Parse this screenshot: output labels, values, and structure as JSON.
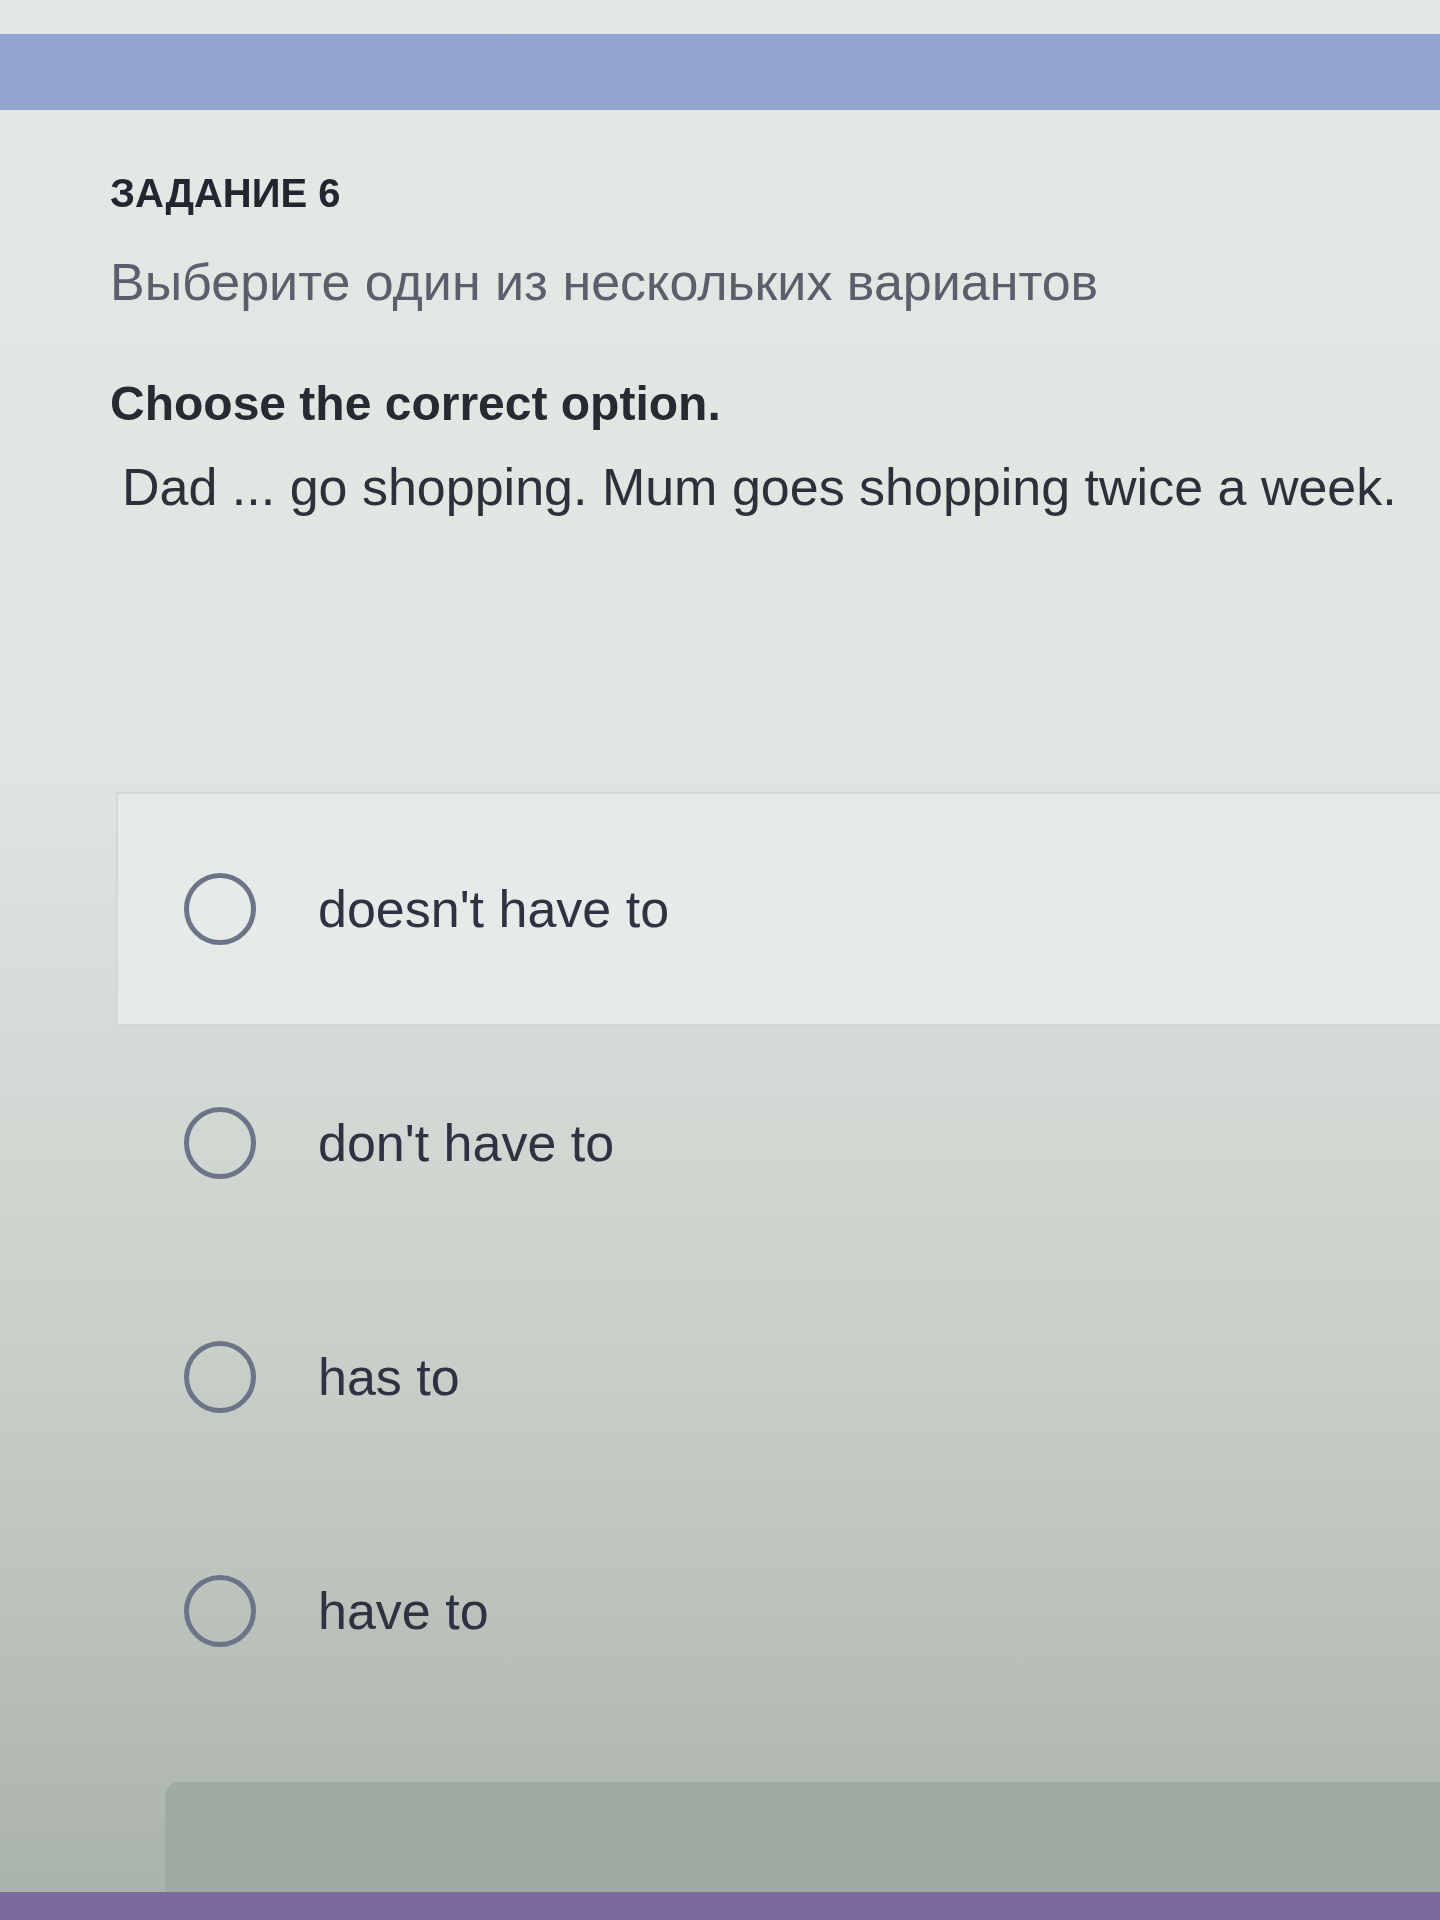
{
  "task": {
    "title": "ЗАДАНИЕ 6",
    "instruction": "Выберите один из нескольких вариантов"
  },
  "question": {
    "prompt": "Choose the correct option.",
    "text": "Dad ... go shopping. Mum goes shopping twice a week."
  },
  "options": [
    {
      "label": "doesn't have to",
      "selected": false,
      "hovered": true
    },
    {
      "label": "don't have to",
      "selected": false,
      "hovered": false
    },
    {
      "label": "has to",
      "selected": false,
      "hovered": false
    },
    {
      "label": "have to",
      "selected": false,
      "hovered": false
    }
  ]
}
